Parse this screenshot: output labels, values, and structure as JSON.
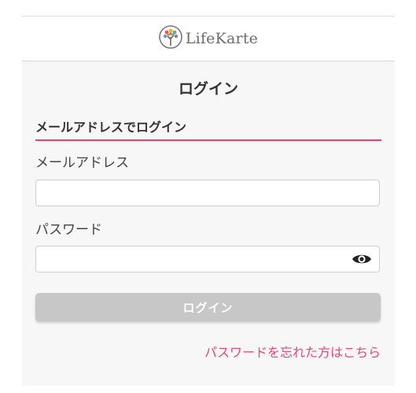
{
  "brand": {
    "logo_text": "LifeKarte"
  },
  "page": {
    "title": "ログイン",
    "section_heading": "メールアドレスでログイン"
  },
  "form": {
    "email_label": "メールアドレス",
    "email_value": "",
    "password_label": "パスワード",
    "password_value": "",
    "show_password_icon": "eye-icon",
    "submit_label": "ログイン",
    "forgot_password_link": "パスワードを忘れた方はこちら"
  },
  "colors": {
    "accent": "#e83f6f",
    "link": "#e8487a",
    "button_disabled": "#c7c7c7",
    "panel_background": "#f7f7f7"
  }
}
